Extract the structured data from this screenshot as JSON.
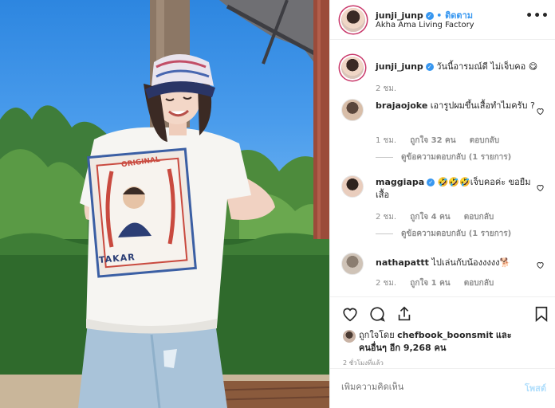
{
  "photo": {
    "shirt_print_top": "ORIGINAL",
    "shirt_print_bottom": "TAKAR"
  },
  "header": {
    "username": "junji_junp",
    "follow_label": "• ติดตาม",
    "location": "Akha Ama Living Factory",
    "more_icon": "more-horizontal-icon"
  },
  "caption": {
    "username": "junji_junp",
    "text": "วันนี้อารมณ์ดี ไม่เจ็บคอ 😋",
    "time": "2 ชม."
  },
  "comments": [
    {
      "username": "brajaojoke",
      "text": "เอารูปผมขึ้นเสื้อทำไมครับ ?",
      "time": "1 ชม.",
      "likes": "ถูกใจ 32 คน",
      "reply": "ตอบกลับ",
      "view_replies": "ดูข้อความตอบกลับ (1 รายการ)"
    },
    {
      "username": "maggiapa",
      "text": "🤣🤣🤣เจ็บคอค่ะ ขอยืมเสื้อ",
      "time": "2 ชม.",
      "likes": "ถูกใจ 4 คน",
      "reply": "ตอบกลับ",
      "view_replies": "ดูข้อความตอบกลับ (1 รายการ)"
    },
    {
      "username": "nathapattt",
      "text": "ไปเล่นกับน้องงงงง🐕",
      "time": "2 ชม.",
      "likes": "ถูกใจ 1 คน",
      "reply": "ตอบกลับ"
    }
  ],
  "actions": {
    "liked_by_prefix": "ถูกใจโดย",
    "liked_by_user": "chefbook_boonsmit",
    "liked_by_and": "และ",
    "others": "คนอื่นๆ อีก 9,268 คน",
    "time_ago": "2 ชั่วโมงที่แล้ว"
  },
  "add_comment": {
    "placeholder": "เพิ่มความคิดเห็น",
    "post_label": "โพสต์"
  },
  "colors": {
    "accent": "#3897f0",
    "story_ring": "#c9386a",
    "muted": "#8e8e8e"
  }
}
